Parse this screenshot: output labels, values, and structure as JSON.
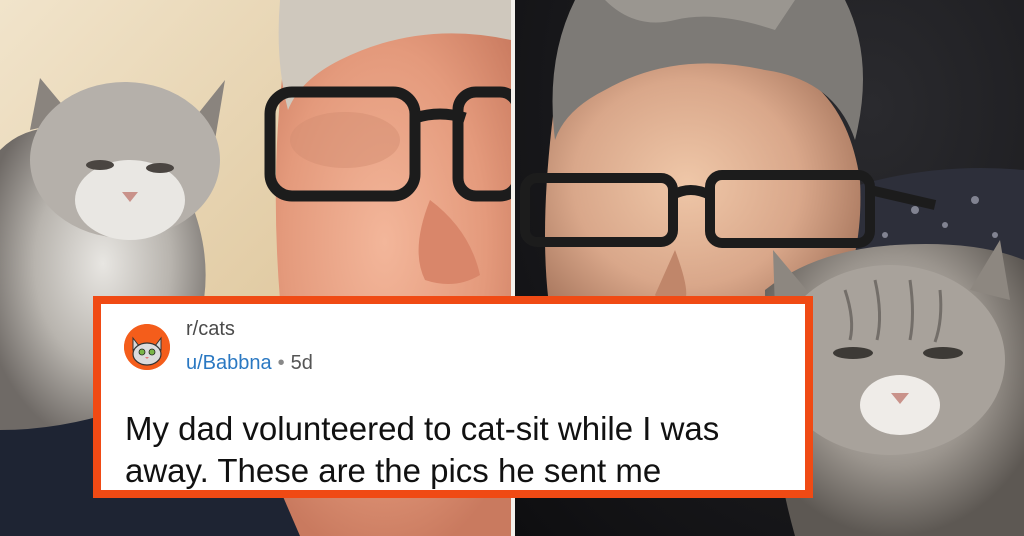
{
  "post": {
    "subreddit": "r/cats",
    "username": "u/Babbna",
    "separator": "•",
    "age": "5d",
    "title": "My dad volunteered to cat-sit while I was away. These are the pics he sent me"
  },
  "colors": {
    "card_border": "#f04a14",
    "username": "#2a78c2",
    "avatar": "#f45d1b"
  }
}
